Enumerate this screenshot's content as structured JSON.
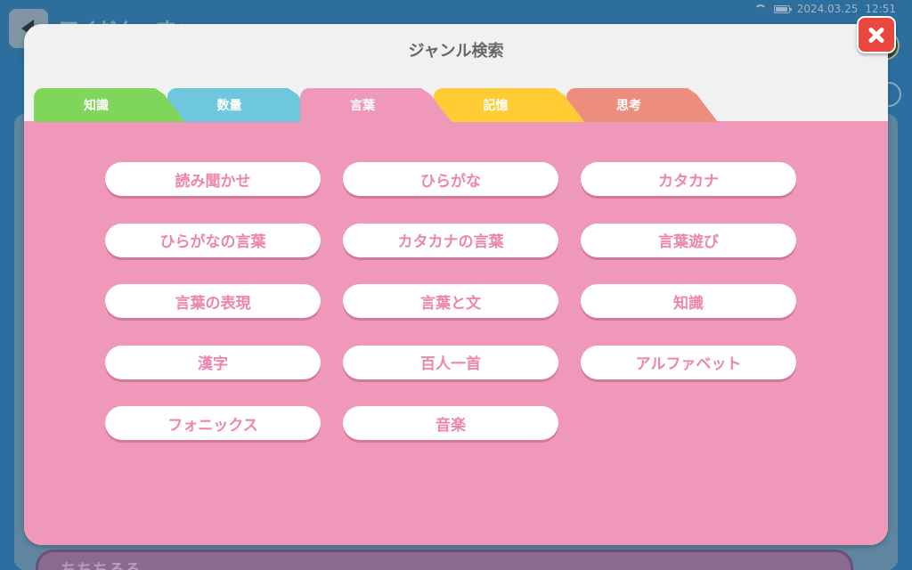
{
  "status_bar": {
    "date": "2024.03.25",
    "time": "12:51"
  },
  "background": {
    "title": "アイだんーすへ",
    "row_text": "ちちちるる"
  },
  "modal": {
    "title": "ジャンル検索",
    "close_icon": "close-icon",
    "tabs": [
      {
        "label": "知識",
        "color": "#7fd65a"
      },
      {
        "label": "数量",
        "color": "#6ec6df"
      },
      {
        "label": "言葉",
        "color": "#f098b9",
        "active": true
      },
      {
        "label": "記憶",
        "color": "#ffcc33"
      },
      {
        "label": "思考",
        "color": "#ec8d7e"
      }
    ],
    "genres": [
      "読み聞かせ",
      "ひらがな",
      "カタカナ",
      "ひらがなの言葉",
      "カタカナの言葉",
      "言葉遊び",
      "言葉の表現",
      "言葉と文",
      "知識",
      "漢字",
      "百人一首",
      "アルファベット",
      "フォニックス",
      "音楽"
    ]
  }
}
